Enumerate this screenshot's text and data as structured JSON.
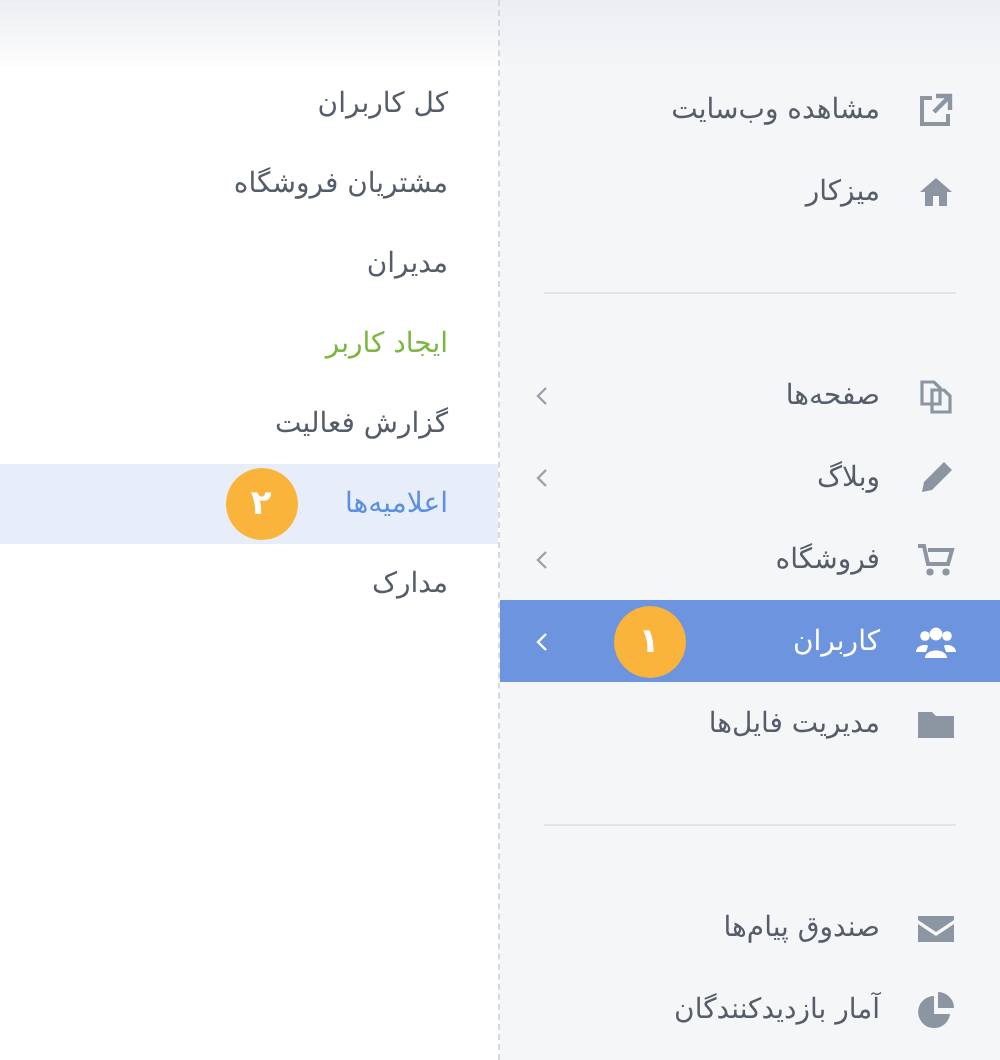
{
  "sidebar": {
    "groups": [
      {
        "items": [
          {
            "label": "مشاهده وب‌سایت",
            "has_submenu": false,
            "selected": false
          },
          {
            "label": "میزکار",
            "has_submenu": false,
            "selected": false
          }
        ]
      },
      {
        "items": [
          {
            "label": "صفحه‌ها",
            "has_submenu": true,
            "selected": false
          },
          {
            "label": "وبلاگ",
            "has_submenu": true,
            "selected": false
          },
          {
            "label": "فروشگاه",
            "has_submenu": true,
            "selected": false
          },
          {
            "label": "کاربران",
            "has_submenu": true,
            "selected": true,
            "badge": "۱"
          },
          {
            "label": "مدیریت فایل‌ها",
            "has_submenu": false,
            "selected": false
          }
        ]
      },
      {
        "items": [
          {
            "label": "صندوق پیام‌ها",
            "has_submenu": false,
            "selected": false
          },
          {
            "label": "آمار بازدیدکنندگان",
            "has_submenu": false,
            "selected": false
          }
        ]
      }
    ]
  },
  "submenu": {
    "items": [
      {
        "label": "کل کاربران",
        "kind": "link",
        "selected": false
      },
      {
        "label": "مشتریان فروشگاه",
        "kind": "link",
        "selected": false
      },
      {
        "label": "مدیران",
        "kind": "link",
        "selected": false
      },
      {
        "label": "ایجاد کاربر",
        "kind": "action",
        "selected": false
      },
      {
        "label": "گزارش فعالیت",
        "kind": "link",
        "selected": false
      },
      {
        "label": "اعلامیه‌ها",
        "kind": "link",
        "selected": true,
        "badge": "۲"
      },
      {
        "label": "مدارک",
        "kind": "link",
        "selected": false
      }
    ]
  }
}
